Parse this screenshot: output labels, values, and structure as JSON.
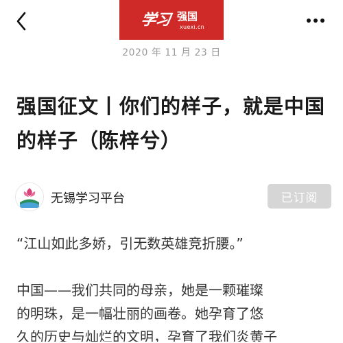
{
  "header": {
    "logo": {
      "script_text": "学习",
      "name": "强国",
      "url": "xuexi.cn",
      "color": "#cf2a27"
    },
    "back_icon": "chevron-left-icon",
    "more_icon": "more-horizontal-icon"
  },
  "article": {
    "date": "2020 年 11 月 23 日",
    "title": "强国征文丨你们的样子，就是中国的样子（陈梓兮）",
    "author": {
      "name": "无锡学习平台",
      "subscribe_label": "已订阅"
    },
    "quote": "“江山如此多娇，引无数英雄竞折腰。”",
    "paragraph_lines": [
      "中国——我们共同的母亲，她是一颗璀璨",
      "的明珠，是一幅壮丽的画卷。她孕育了悠",
      "久的历史与灿烂的文明，孕育了我们炎黄子"
    ]
  }
}
